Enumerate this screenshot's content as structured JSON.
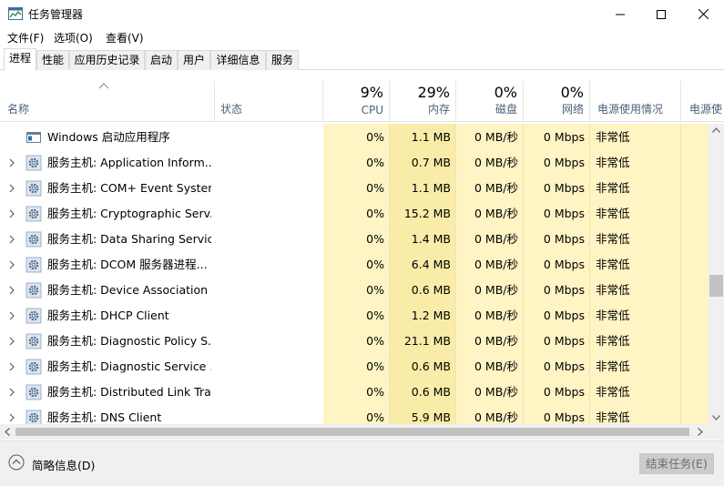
{
  "window": {
    "title": "任务管理器"
  },
  "menu": [
    "文件(F)",
    "选项(O)",
    "查看(V)"
  ],
  "tabs": [
    "进程",
    "性能",
    "应用历史记录",
    "启动",
    "用户",
    "详细信息",
    "服务"
  ],
  "header": {
    "name": "名称",
    "status": "状态",
    "cpu": {
      "pct": "9%",
      "label": "CPU"
    },
    "memory": {
      "pct": "29%",
      "label": "内存"
    },
    "disk": {
      "pct": "0%",
      "label": "磁盘"
    },
    "network": {
      "pct": "0%",
      "label": "网络"
    },
    "power": "电源使用情况",
    "power_trend": "电源使"
  },
  "rows": [
    {
      "name": "Windows 启动应用程序",
      "cpu": "0%",
      "mem": "1.1 MB",
      "disk": "0 MB/秒",
      "net": "0 Mbps",
      "power": "非常低",
      "icon": "window-icon",
      "expandable": false
    },
    {
      "name": "服务主机: Application Inform...",
      "cpu": "0%",
      "mem": "0.7 MB",
      "disk": "0 MB/秒",
      "net": "0 Mbps",
      "power": "非常低",
      "icon": "gear-icon",
      "expandable": true
    },
    {
      "name": "服务主机: COM+ Event System",
      "cpu": "0%",
      "mem": "1.1 MB",
      "disk": "0 MB/秒",
      "net": "0 Mbps",
      "power": "非常低",
      "icon": "gear-icon",
      "expandable": true
    },
    {
      "name": "服务主机: Cryptographic Serv...",
      "cpu": "0%",
      "mem": "15.2 MB",
      "disk": "0 MB/秒",
      "net": "0 Mbps",
      "power": "非常低",
      "icon": "gear-icon",
      "expandable": true
    },
    {
      "name": "服务主机: Data Sharing Service",
      "cpu": "0%",
      "mem": "1.4 MB",
      "disk": "0 MB/秒",
      "net": "0 Mbps",
      "power": "非常低",
      "icon": "gear-icon",
      "expandable": true
    },
    {
      "name": "服务主机: DCOM 服务器进程...",
      "cpu": "0%",
      "mem": "6.4 MB",
      "disk": "0 MB/秒",
      "net": "0 Mbps",
      "power": "非常低",
      "icon": "gear-icon",
      "expandable": true
    },
    {
      "name": "服务主机: Device Association ...",
      "cpu": "0%",
      "mem": "0.6 MB",
      "disk": "0 MB/秒",
      "net": "0 Mbps",
      "power": "非常低",
      "icon": "gear-icon",
      "expandable": true
    },
    {
      "name": "服务主机: DHCP Client",
      "cpu": "0%",
      "mem": "1.2 MB",
      "disk": "0 MB/秒",
      "net": "0 Mbps",
      "power": "非常低",
      "icon": "gear-icon",
      "expandable": true
    },
    {
      "name": "服务主机: Diagnostic Policy S...",
      "cpu": "0%",
      "mem": "21.1 MB",
      "disk": "0 MB/秒",
      "net": "0 Mbps",
      "power": "非常低",
      "icon": "gear-icon",
      "expandable": true
    },
    {
      "name": "服务主机: Diagnostic Service ...",
      "cpu": "0%",
      "mem": "0.6 MB",
      "disk": "0 MB/秒",
      "net": "0 Mbps",
      "power": "非常低",
      "icon": "gear-icon",
      "expandable": true
    },
    {
      "name": "服务主机: Distributed Link Tra...",
      "cpu": "0%",
      "mem": "0.6 MB",
      "disk": "0 MB/秒",
      "net": "0 Mbps",
      "power": "非常低",
      "icon": "gear-icon",
      "expandable": true
    },
    {
      "name": "服务主机: DNS Client",
      "cpu": "0%",
      "mem": "5.9 MB",
      "disk": "0 MB/秒",
      "net": "0 Mbps",
      "power": "非常低",
      "icon": "gear-icon",
      "expandable": true
    }
  ],
  "footer": {
    "fewer_details": "简略信息(D)",
    "end_task": "结束任务(E)"
  },
  "colors": {
    "heat_light": "#fff4c4",
    "heat_medium": "#f9eca8",
    "header_label": "#4c607a"
  }
}
